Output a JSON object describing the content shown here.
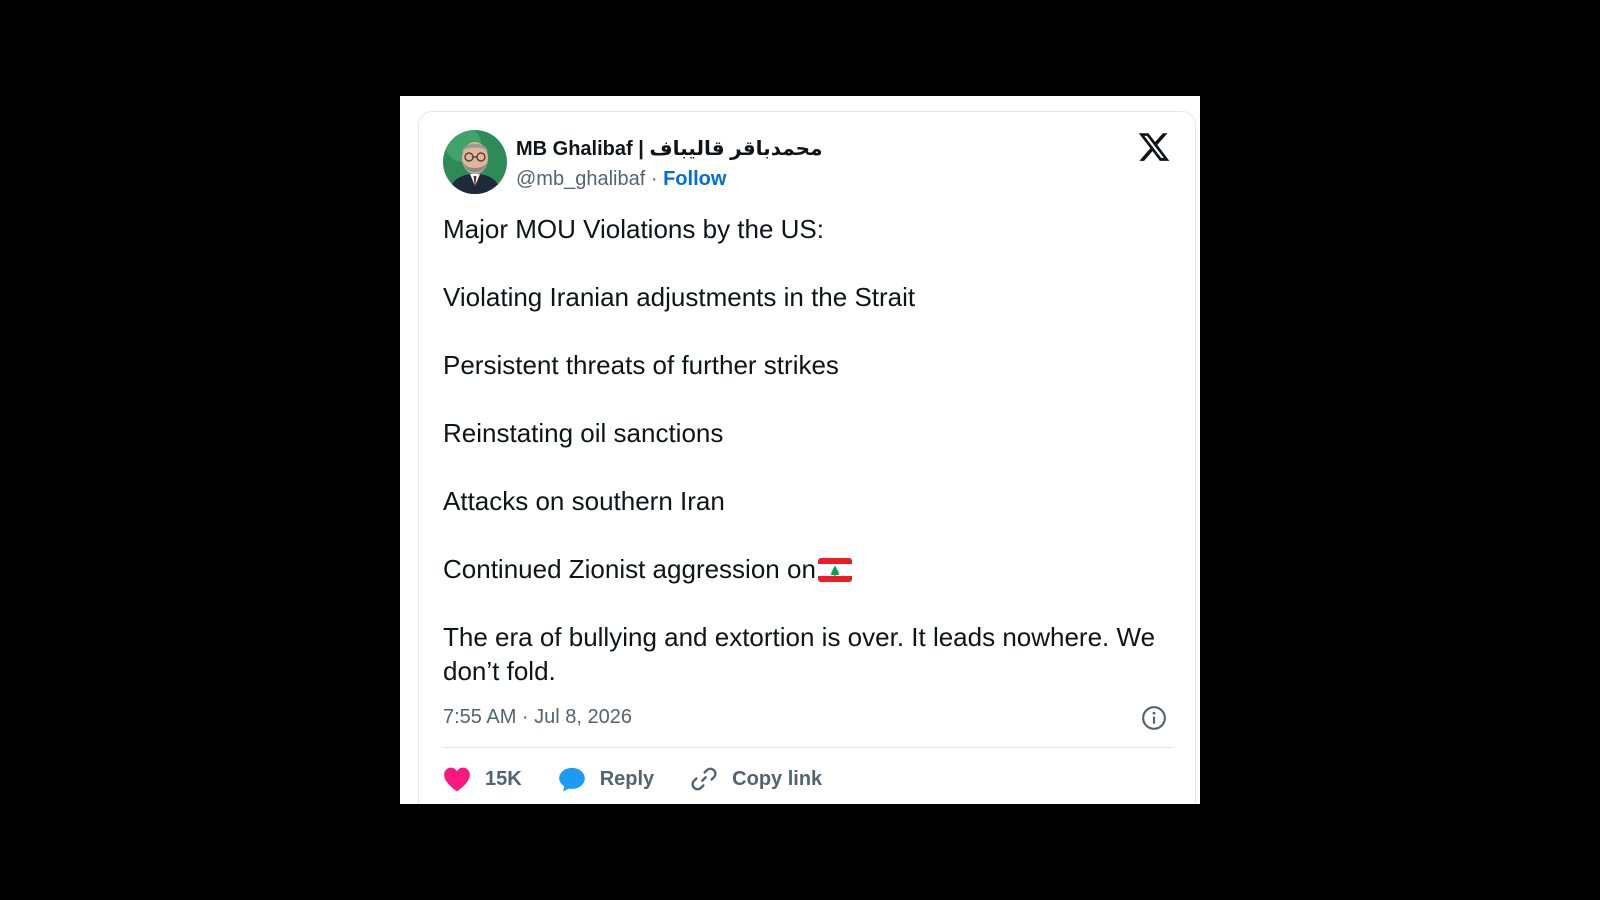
{
  "tweet": {
    "author": {
      "name": "MB Ghalibaf | محمدباقر قالیباف",
      "handle": "@mb_ghalibaf",
      "separator": "·",
      "follow_label": "Follow",
      "avatar_icon": "profile-photo"
    },
    "platform_icon": "x-logo-icon",
    "paragraphs": [
      "Major MOU Violations by the US:",
      "Violating Iranian adjustments in the Strait",
      "Persistent threats of further strikes",
      "Reinstating oil sanctions",
      "Attacks on southern Iran",
      "Continued Zionist aggression on",
      "The era of bullying and extortion is over. It leads nowhere. We don’t fold."
    ],
    "inline_emoji": "lebanon-flag-icon",
    "timestamp": "7:55 AM · Jul 8, 2026",
    "actions": {
      "like_count": "15K",
      "reply_label": "Reply",
      "copy_link_label": "Copy link"
    }
  },
  "colors": {
    "background": "#000000",
    "card": "#ffffff",
    "text": "#0f1419",
    "secondary_text": "#536471",
    "link": "#006fd6",
    "like": "#f91880",
    "reply": "#1d9bf0",
    "border": "#e1e8ed"
  }
}
